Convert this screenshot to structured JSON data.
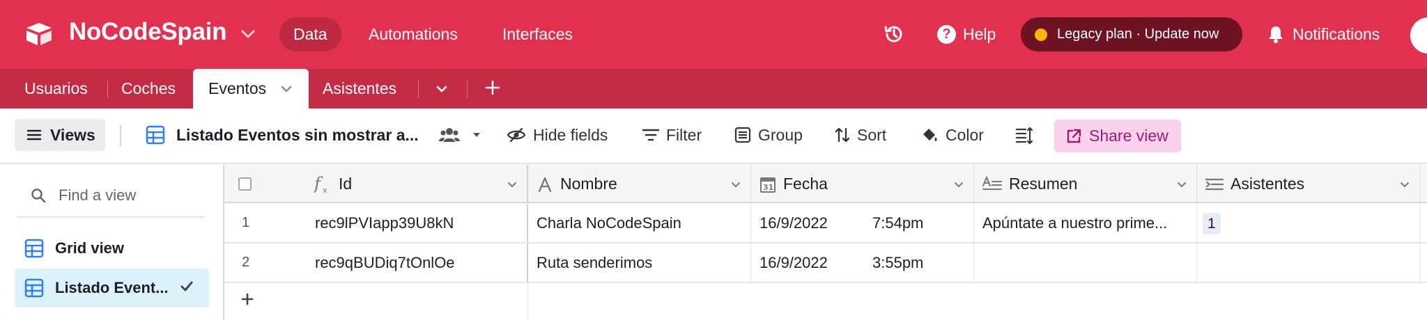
{
  "topbar": {
    "base_name": "NoCodeSpain",
    "nav": [
      "Data",
      "Automations",
      "Interfaces"
    ],
    "help": "Help",
    "legacy": "Legacy plan · Update now",
    "notifications": "Notifications"
  },
  "tables": {
    "items": [
      "Usuarios",
      "Coches",
      "Eventos",
      "Asistentes"
    ],
    "active": "Eventos"
  },
  "viewbar": {
    "views": "Views",
    "view_name": "Listado Eventos sin mostrar a...",
    "hide_fields": "Hide fields",
    "filter": "Filter",
    "group": "Group",
    "sort": "Sort",
    "color": "Color",
    "share_view": "Share view"
  },
  "sidebar": {
    "find_placeholder": "Find a view",
    "views": [
      {
        "label": "Grid view",
        "active": false
      },
      {
        "label": "Listado Event...",
        "active": true
      }
    ]
  },
  "grid": {
    "columns": [
      {
        "label": "Id",
        "icon": "formula-icon"
      },
      {
        "label": "Nombre",
        "icon": "text-icon"
      },
      {
        "label": "Fecha",
        "icon": "calendar-icon"
      },
      {
        "label": "Resumen",
        "icon": "long-text-icon"
      },
      {
        "label": "Asistentes",
        "icon": "link-icon"
      }
    ],
    "rows": [
      {
        "num": "1",
        "id": "rec9lPVIapp39U8kN",
        "nombre": "Charla NoCodeSpain",
        "fecha": "16/9/2022",
        "hora": "7:54pm",
        "resumen": "Apúntate a nuestro prime...",
        "asistentes": "1"
      },
      {
        "num": "2",
        "id": "rec9qBUDiq7tOnlOe",
        "nombre": "Ruta senderimos",
        "fecha": "16/9/2022",
        "hora": "3:55pm",
        "resumen": "",
        "asistentes": ""
      }
    ],
    "add_row": "+"
  },
  "colors": {
    "brand": "#e2314e",
    "tabs_bg": "#c42b45",
    "legacy_bg": "#6d1323",
    "legacy_dot": "#fcb400",
    "share_bg": "#fbd2ee",
    "view_icon": "#2d7ff9"
  }
}
